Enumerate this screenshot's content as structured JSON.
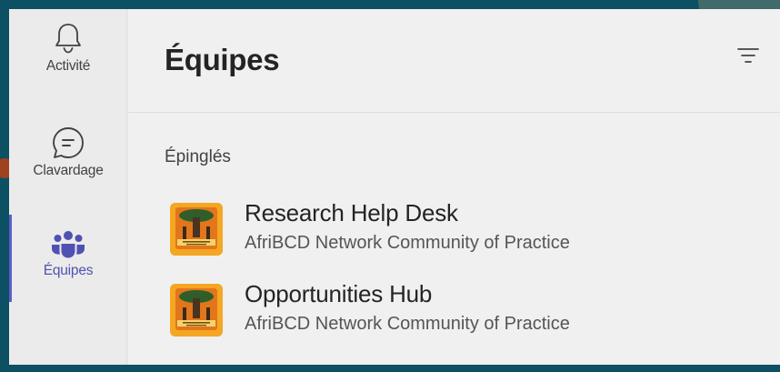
{
  "app": {
    "accent_color": "#5b5fc7",
    "background_color": "#0d4f63"
  },
  "rail": {
    "items": [
      {
        "label": "Activité",
        "icon": "bell-icon"
      },
      {
        "label": "Clavardage",
        "icon": "chat-icon"
      },
      {
        "label": "Équipes",
        "icon": "teams-icon",
        "active": true
      }
    ]
  },
  "panel": {
    "title": "Équipes",
    "filter_icon": "filter-icon",
    "section_label": "Épinglés",
    "teams": [
      {
        "name": "Research Help Desk",
        "subtitle": "AfriBCD Network Community of Practice"
      },
      {
        "name": "Opportunities Hub",
        "subtitle": "AfriBCD Network Community of Practice"
      }
    ]
  }
}
